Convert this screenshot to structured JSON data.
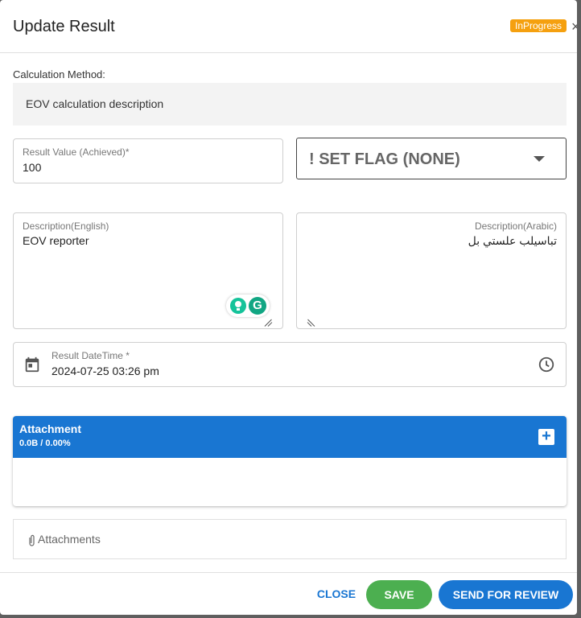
{
  "dialog": {
    "title": "Update Result",
    "status_badge": "InProgress",
    "close_glyph": "×"
  },
  "calculation": {
    "label": "Calculation Method:",
    "description": "EOV calculation description"
  },
  "result_value": {
    "label": "Result Value (Achieved)*",
    "value": "100"
  },
  "flag": {
    "selected": "! SET FLAG (NONE)"
  },
  "description_english": {
    "label": "Description(English)",
    "value": "EOV reporter"
  },
  "description_arabic": {
    "label": "Description(Arabic)",
    "value": "تباسيلب علستي بل"
  },
  "result_datetime": {
    "label": "Result DateTime *",
    "value": "2024-07-25 03:26 pm"
  },
  "attachment_panel": {
    "title": "Attachment",
    "size_info": "0.0B / 0.00%",
    "add_glyph": "+"
  },
  "attachments": {
    "clip_glyph": "⌀",
    "label": "Attachments"
  },
  "footer": {
    "close_label": "CLOSE",
    "save_label": "SAVE",
    "review_label": "SEND FOR REVIEW"
  },
  "grammarly": {
    "logo_letter": "G"
  },
  "colors": {
    "primary": "#1976d2",
    "success": "#4caf50",
    "badge": "#f5a00f"
  },
  "icons": [
    "close-icon",
    "chevron-down-icon",
    "calendar-icon",
    "clock-icon",
    "plus-icon",
    "paperclip-icon",
    "grammarly-bulb-icon",
    "grammarly-logo-icon",
    "resize-handle-icon"
  ]
}
